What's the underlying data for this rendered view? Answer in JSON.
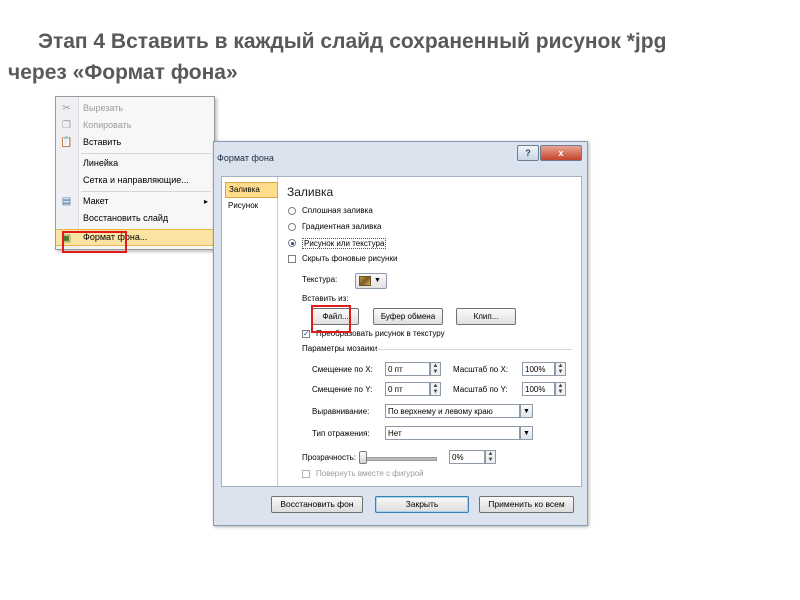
{
  "slide": {
    "title_line1": "Этап 4 Вставить в каждый слайд  сохраненный рисунок *jpg",
    "title_line2": "через «Формат фона»"
  },
  "context_menu": {
    "items": [
      {
        "label": "Вырезать",
        "icon": "scissors-icon",
        "disabled": true
      },
      {
        "label": "Копировать",
        "icon": "copy-icon",
        "disabled": true
      },
      {
        "label": "Вставить",
        "icon": "paste-icon",
        "disabled": false
      },
      {
        "label": "Линейка",
        "icon": "",
        "disabled": false
      },
      {
        "label": "Сетка и направляющие...",
        "icon": "",
        "disabled": false
      },
      {
        "label": "Макет",
        "icon": "layout-icon",
        "disabled": false,
        "submenu": true
      },
      {
        "label": "Восстановить слайд",
        "icon": "",
        "disabled": false
      },
      {
        "label": "Формат фона...",
        "icon": "format-background-icon",
        "disabled": false,
        "highlighted": true
      }
    ],
    "submenu_arrow": "▸"
  },
  "dialog": {
    "title": "Формат фона",
    "help_btn": "?",
    "close_btn": "x",
    "nav": [
      "Заливка",
      "Рисунок"
    ],
    "fill_header": "Заливка",
    "radios": [
      "Сплошная заливка",
      "Градиентная заливка",
      "Рисунок или текстура"
    ],
    "selected_radio": 2,
    "hide_bg_label": "Скрыть фоновые рисунки",
    "texture_label": "Текстура:",
    "insert_from_label": "Вставить из:",
    "buttons_insert": [
      "Файл...",
      "Буфер обмена",
      "Клип..."
    ],
    "tile_checkbox_label": "Преобразовать рисунок в текстуру",
    "tile_params_label": "Параметры мозаики",
    "offset_x_label": "Смещение по X:",
    "offset_x_value": "0 пт",
    "offset_y_label": "Смещение по Y:",
    "offset_y_value": "0 пт",
    "scale_x_label": "Масштаб по X:",
    "scale_x_value": "100%",
    "scale_y_label": "Масштаб по Y:",
    "scale_y_value": "100%",
    "alignment_label": "Выравнивание:",
    "alignment_value": "По верхнему и левому краю",
    "mirror_label": "Тип отражения:",
    "mirror_value": "Нет",
    "transparency_label": "Прозрачность:",
    "transparency_value": "0%",
    "rotate_label": "Повернуть вместе с фигурой",
    "footer": [
      "Восстановить фон",
      "Закрыть",
      "Применить ко всем"
    ],
    "spin_up": "▲",
    "spin_down": "▼",
    "combo_arrow": "▼"
  }
}
